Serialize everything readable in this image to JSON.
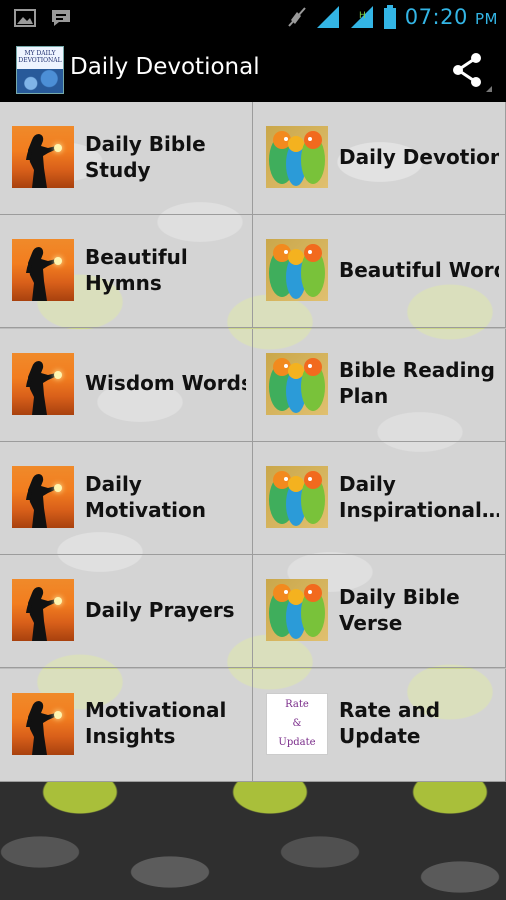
{
  "status_bar": {
    "time": "07:20",
    "ampm": "PM",
    "icons": [
      "image-icon",
      "chat-icon",
      "mute-icon",
      "signal-icon",
      "wifi-icon",
      "battery-icon"
    ]
  },
  "action_bar": {
    "logo_text": "MY DAILY DEVOTIONAL",
    "title": "Daily Devotional",
    "share_icon": "share-icon"
  },
  "colors": {
    "clock": "#33b5e5",
    "action_bar_bg": "#000000",
    "tile_text": "#111111"
  },
  "tiles": [
    {
      "label_lines": [
        "Daily Bible",
        "Study"
      ],
      "icon": "silhouette-icon"
    },
    {
      "label_lines": [
        "Daily Devotion"
      ],
      "icon": "parrots-icon"
    },
    {
      "label_lines": [
        "Beautiful",
        "Hymns"
      ],
      "icon": "silhouette-icon"
    },
    {
      "label_lines": [
        "Beautiful Words"
      ],
      "icon": "parrots-icon"
    },
    {
      "label_lines": [
        "Wisdom Words"
      ],
      "icon": "silhouette-icon"
    },
    {
      "label_lines": [
        "Bible Reading",
        "Plan"
      ],
      "icon": "parrots-icon"
    },
    {
      "label_lines": [
        "Daily",
        "Motivation"
      ],
      "icon": "silhouette-icon"
    },
    {
      "label_lines": [
        "Daily",
        "Inspirational…"
      ],
      "icon": "parrots-icon"
    },
    {
      "label_lines": [
        "Daily Prayers"
      ],
      "icon": "silhouette-icon"
    },
    {
      "label_lines": [
        "Daily Bible",
        "Verse"
      ],
      "icon": "parrots-icon"
    },
    {
      "label_lines": [
        "Motivational",
        "Insights"
      ],
      "icon": "silhouette-icon"
    },
    {
      "label_lines": [
        "Rate and",
        "Update"
      ],
      "icon": "rate-update-icon",
      "icon_text": [
        "Rate",
        "&",
        "Update"
      ]
    }
  ]
}
